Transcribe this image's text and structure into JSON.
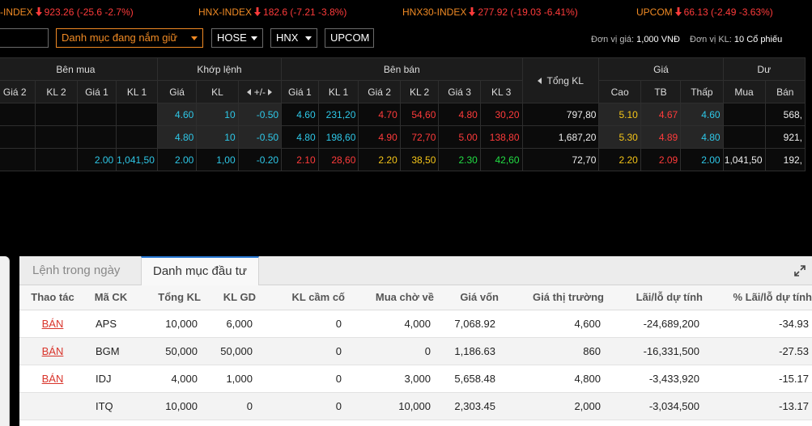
{
  "ticker": [
    {
      "name": "-INDEX",
      "value": "923.26 (-25.6 -2.7%)"
    },
    {
      "name": "HNX-INDEX",
      "value": "182.6 (-7.21 -3.8%)"
    },
    {
      "name": "HNX30-INDEX",
      "value": "277.92 (-19.03 -6.41%)"
    },
    {
      "name": "UPCOM",
      "value": "66.13 (-2.49 -3.63%)"
    }
  ],
  "toolbar": {
    "search_value": "",
    "watchlist": "Danh mục đang nắm giữ",
    "exchanges": [
      "HOSE",
      "HNX",
      "UPCOM"
    ],
    "unit_price_label": "Đơn vị giá:",
    "unit_price_value": "1,000 VNĐ",
    "unit_vol_label": "Đơn vị KL:",
    "unit_vol_value": "10 Cổ phiếu"
  },
  "board": {
    "groups": {
      "buy": "Bên mua",
      "match": "Khớp lệnh",
      "sell": "Bên bán",
      "total": "Tổng KL",
      "price": "Giá",
      "remain": "Dư"
    },
    "cols": {
      "buy": [
        "Giá 2",
        "KL 2",
        "Giá 1",
        "KL 1"
      ],
      "match": [
        "Giá",
        "KL",
        "+/-"
      ],
      "sell": [
        "Giá 1",
        "KL 1",
        "Giá 2",
        "KL 2",
        "Giá 3",
        "KL 3"
      ],
      "price": [
        "Cao",
        "TB",
        "Thấp"
      ],
      "remain": [
        "Mua",
        "Bán"
      ]
    },
    "rows": [
      {
        "b_g2": "",
        "b_k2": "",
        "b_g1": "",
        "b_k1": "",
        "m_g": "4.60",
        "m_k": "10",
        "m_d": "-0.50",
        "s_g1": "4.60",
        "s_k1": "231,20",
        "s_g2": "4.70",
        "s_k2": "54,60",
        "s_g3": "4.80",
        "s_k3": "30,20",
        "tot": "797,80",
        "hi": "5.10",
        "avg": "4.67",
        "lo": "4.60",
        "r_b": "",
        "r_s": "568,"
      },
      {
        "b_g2": "",
        "b_k2": "",
        "b_g1": "",
        "b_k1": "",
        "m_g": "4.80",
        "m_k": "10",
        "m_d": "-0.50",
        "s_g1": "4.80",
        "s_k1": "198,60",
        "s_g2": "4.90",
        "s_k2": "72,70",
        "s_g3": "5.00",
        "s_k3": "138,80",
        "tot": "1,687,20",
        "hi": "5.30",
        "avg": "4.89",
        "lo": "4.80",
        "r_b": "",
        "r_s": "921,"
      },
      {
        "b_g2": "",
        "b_k2": "",
        "b_g1": "2.00",
        "b_k1": "1,041,50",
        "m_g": "2.00",
        "m_k": "1,00",
        "m_d": "-0.20",
        "s_g1": "2.10",
        "s_k1": "28,60",
        "s_g2": "2.20",
        "s_k2": "38,50",
        "s_g3": "2.30",
        "s_k3": "42,60",
        "tot": "72,70",
        "hi": "2.20",
        "avg": "2.09",
        "lo": "2.00",
        "r_b": "1,041,50",
        "r_s": "192,"
      }
    ]
  },
  "tabs": [
    "Lệnh trong ngày",
    "Danh mục đầu tư"
  ],
  "portfolio": {
    "headers": [
      "Thao tác",
      "Mã CK",
      "Tổng KL",
      "KL GD",
      "KL cầm cố",
      "Mua chờ về",
      "Giá vốn",
      "Giá thị trường",
      "Lãi/lỗ dự tính",
      "% Lãi/lỗ dự tính"
    ],
    "rows": [
      {
        "action": "BÁN",
        "code": "APS",
        "total": "10,000",
        "trade": "6,000",
        "pledge": "0",
        "pending": "4,000",
        "cost": "7,068.92",
        "market": "4,600",
        "pnl": "-24,689,200",
        "pct": "-34.93"
      },
      {
        "action": "BÁN",
        "code": "BGM",
        "total": "50,000",
        "trade": "50,000",
        "pledge": "0",
        "pending": "0",
        "cost": "1,186.63",
        "market": "860",
        "pnl": "-16,331,500",
        "pct": "-27.53"
      },
      {
        "action": "BÁN",
        "code": "IDJ",
        "total": "4,000",
        "trade": "1,000",
        "pledge": "0",
        "pending": "3,000",
        "cost": "5,658.48",
        "market": "4,800",
        "pnl": "-3,433,920",
        "pct": "-15.17"
      },
      {
        "action": "",
        "code": "ITQ",
        "total": "10,000",
        "trade": "0",
        "pledge": "0",
        "pending": "10,000",
        "cost": "2,303.45",
        "market": "2,000",
        "pnl": "-3,034,500",
        "pct": "-13.17"
      }
    ]
  },
  "colors": {
    "up": "#22dd44",
    "down": "#ff3b3b",
    "ref": "#f5c518",
    "floor": "#2ec8e8",
    "accent": "#f08a24"
  }
}
